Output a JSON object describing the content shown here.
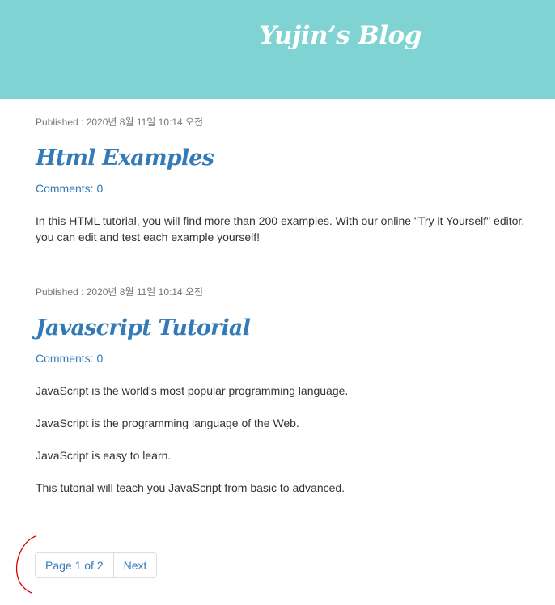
{
  "header": {
    "site_title": "Yujin’s Blog",
    "background_color": "#7fd4d3"
  },
  "posts": [
    {
      "meta": "Published : 2020년 8월 11일 10:14 오전",
      "title": "Html Examples",
      "comments": "Comments: 0",
      "paragraphs": [
        "In this HTML tutorial, you will find more than 200 examples. With our online \"Try it Yourself\" editor, you can edit and test each example yourself!"
      ]
    },
    {
      "meta": "Published : 2020년 8월 11일 10:14 오전",
      "title": "Javascript Tutorial",
      "comments": "Comments: 0",
      "paragraphs": [
        "JavaScript is the world's most popular programming language.",
        "JavaScript is the programming language of the Web.",
        "JavaScript is easy to learn.",
        "This tutorial will teach you JavaScript from basic to advanced."
      ]
    }
  ],
  "pagination": {
    "page_label": "Page 1 of 2",
    "next_label": "Next"
  },
  "colors": {
    "link": "#337ab7",
    "annotation": "#e00000"
  }
}
